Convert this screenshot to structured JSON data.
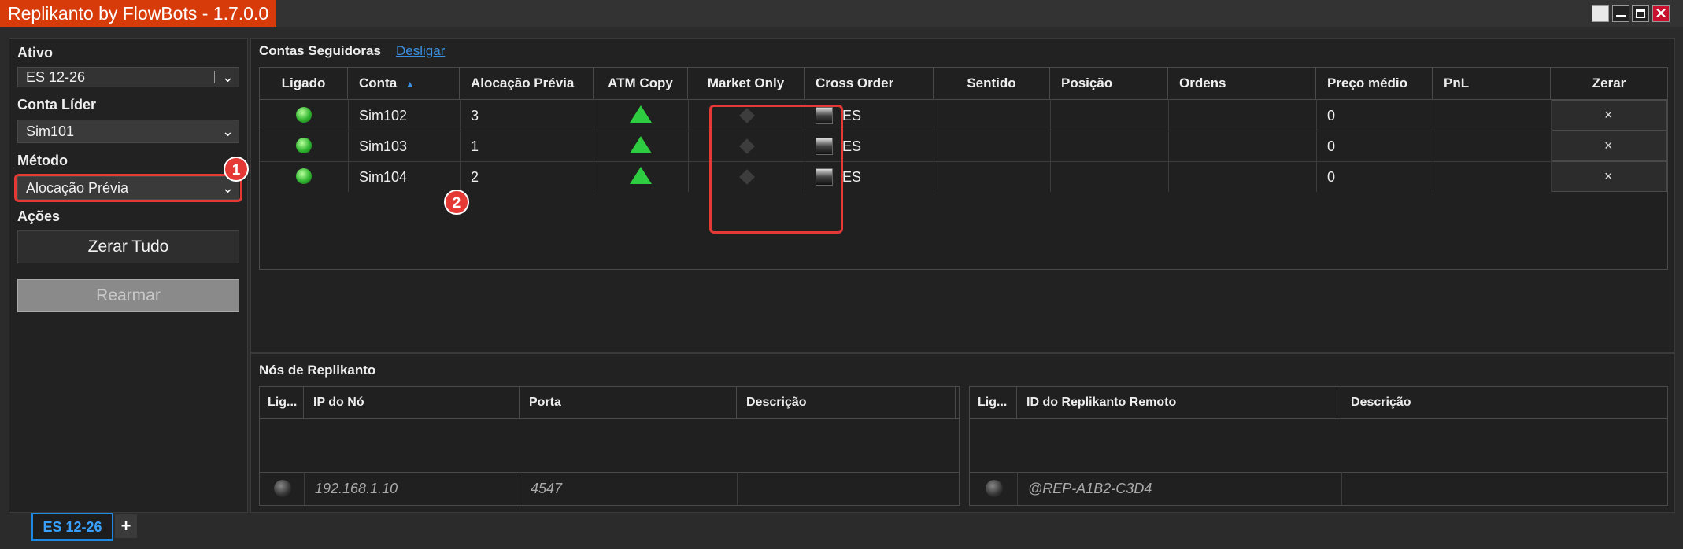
{
  "window": {
    "title": "Replikanto by FlowBots - 1.7.0.0",
    "close_glyph": "✕"
  },
  "left": {
    "ativo_label": "Ativo",
    "ativo_value": "ES 12-26",
    "conta_lider_label": "Conta Líder",
    "conta_lider_value": "Sim101",
    "metodo_label": "Método",
    "metodo_value": "Alocação Prévia",
    "acoes_label": "Ações",
    "zerar_tudo": "Zerar Tudo",
    "rearmar": "Rearmar",
    "badge1": "1"
  },
  "contas": {
    "title": "Contas Seguidoras",
    "link": "Desligar",
    "badge2": "2",
    "headers": [
      "Ligado",
      "Conta",
      "Alocação Prévia",
      "ATM Copy",
      "Market Only",
      "Cross Order",
      "Sentido",
      "Posição",
      "Ordens",
      "Preço médio",
      "PnL",
      "Zerar"
    ],
    "sort_arrow": "▲",
    "rows": [
      {
        "conta": "Sim102",
        "alocacao": "3",
        "cross": "ES",
        "preco": "0",
        "zerar": "×"
      },
      {
        "conta": "Sim103",
        "alocacao": "1",
        "cross": "ES",
        "preco": "0",
        "zerar": "×"
      },
      {
        "conta": "Sim104",
        "alocacao": "2",
        "cross": "ES",
        "preco": "0",
        "zerar": "×"
      }
    ]
  },
  "nos": {
    "title": "Nós de Replikanto",
    "left_headers": [
      "Lig...",
      "IP do Nó",
      "Porta",
      "Descrição"
    ],
    "left_row": {
      "ip": "192.168.1.10",
      "porta": "4547"
    },
    "right_headers": [
      "Lig...",
      "ID do Replikanto Remoto",
      "Descrição"
    ],
    "right_row": {
      "id": "@REP-A1B2-C3D4"
    }
  },
  "tabs": {
    "active": "ES 12-26",
    "add": "+"
  },
  "colors": {
    "title_bg": "#d83b0a",
    "highlight": "#e53935",
    "link": "#3a8fe0",
    "tab_accent": "#1e88e5"
  }
}
